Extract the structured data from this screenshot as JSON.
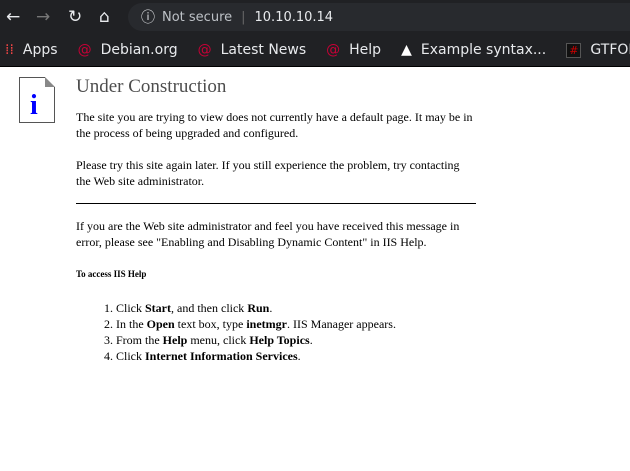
{
  "browser": {
    "security": "Not secure",
    "url": "10.10.10.14",
    "bookmarks": [
      {
        "label": "Apps",
        "icon": "apps-grid-icon"
      },
      {
        "label": "Debian.org",
        "icon": "debian-icon"
      },
      {
        "label": "Latest News",
        "icon": "debian-icon"
      },
      {
        "label": "Help",
        "icon": "debian-icon"
      },
      {
        "label": "Example syntax...",
        "icon": "linux-tux-icon"
      },
      {
        "label": "GTFOBins",
        "icon": "gtfobins-icon"
      }
    ]
  },
  "page": {
    "title": "Under Construction",
    "p1": "The site you are trying to view does not currently have a default page. It may be in the process of being upgraded and configured.",
    "p2": "Please try this site again later. If you still experience the problem, try contacting the Web site administrator.",
    "p3": "If you are the Web site administrator and feel you have received this message in error, please see \"Enabling and Disabling Dynamic Content\" in IIS Help.",
    "help_heading": "To access IIS Help",
    "steps": [
      {
        "a": "Click ",
        "b": "Start",
        "c": ", and then click ",
        "d": "Run",
        "e": "."
      },
      {
        "a": "In the ",
        "b": "Open",
        "c": " text box, type ",
        "d": "inetmgr",
        "e": ". IIS Manager appears."
      },
      {
        "a": "From the ",
        "b": "Help",
        "c": " menu, click ",
        "d": "Help Topics",
        "e": "."
      },
      {
        "a": "Click ",
        "b": "Internet Information Services",
        "c": "",
        "d": "",
        "e": "."
      }
    ]
  }
}
